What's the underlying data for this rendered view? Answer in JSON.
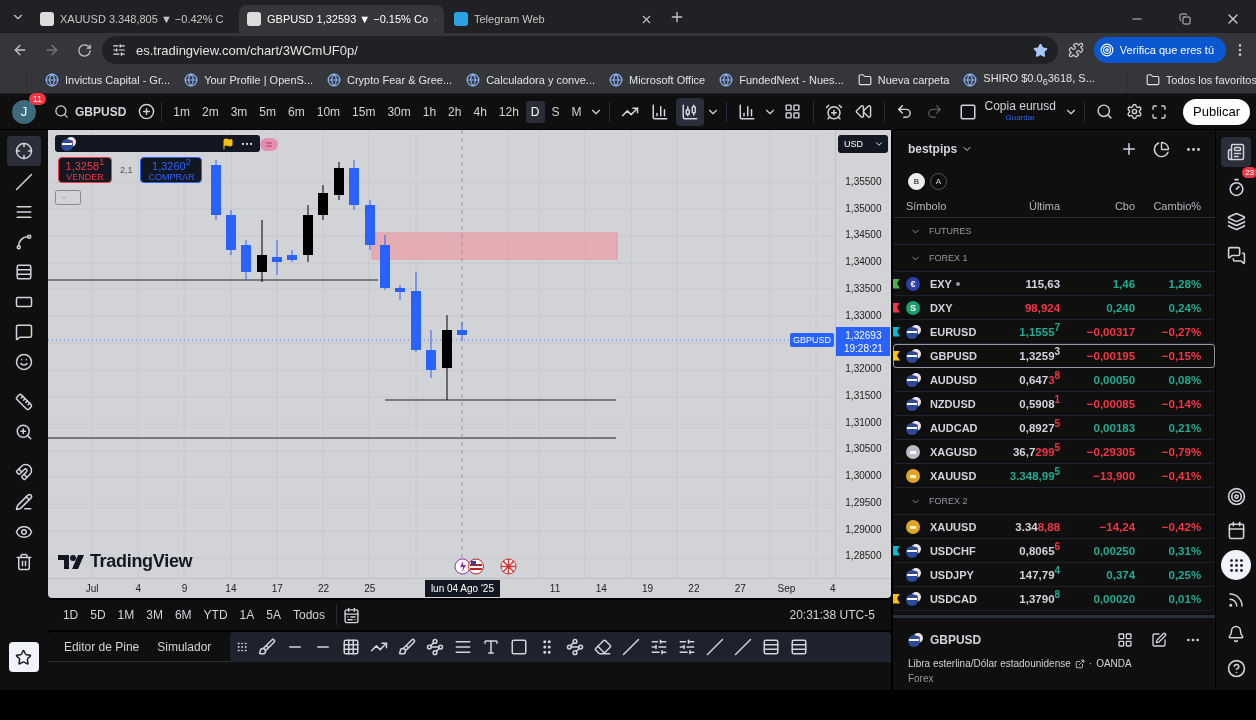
{
  "browser": {
    "tabs": [
      {
        "title": "XAUUSD 3.348,805 ▼ −0.42% C",
        "selected": false
      },
      {
        "title": "GBPUSD 1,32593 ▼ −0.15% Co",
        "selected": true
      },
      {
        "title": "Telegram Web",
        "selected": false
      }
    ],
    "url": "es.tradingview.com/chart/3WCmUF0p/",
    "verify": "Verifica que eres tú",
    "bookmarks": [
      {
        "label": "Invictus Capital - Gr...",
        "kind": "site"
      },
      {
        "label": "Your Profile | OpenS...",
        "kind": "site"
      },
      {
        "label": "Crypto Fear & Gree...",
        "kind": "site"
      },
      {
        "label": "Calculadora y conve...",
        "kind": "site"
      },
      {
        "label": "Microsoft Office",
        "kind": "site"
      },
      {
        "label": "FundedNext - Nues...",
        "kind": "site"
      },
      {
        "label": "Nueva carpeta",
        "kind": "folder"
      },
      {
        "label": "SHIRO $0.0$_{6}$3618, S...",
        "kind": "site"
      }
    ],
    "all_bookmarks": "Todos los favoritos"
  },
  "toolbar": {
    "avatar": "J",
    "badge": "11",
    "symbol": "GBPUSD",
    "intervals": [
      {
        "label": "1m",
        "selected": false
      },
      {
        "label": "2m",
        "selected": false
      },
      {
        "label": "3m",
        "selected": false
      },
      {
        "label": "5m",
        "selected": false
      },
      {
        "label": "6m",
        "selected": false
      },
      {
        "label": "10m",
        "selected": false
      },
      {
        "label": "15m",
        "selected": false
      },
      {
        "label": "30m",
        "selected": false
      },
      {
        "label": "1h",
        "selected": false
      },
      {
        "label": "2h",
        "selected": false
      },
      {
        "label": "4h",
        "selected": false
      },
      {
        "label": "12h",
        "selected": false
      },
      {
        "label": "D",
        "selected": true
      },
      {
        "label": "S",
        "selected": false
      },
      {
        "label": "M",
        "selected": false
      }
    ],
    "layout_name": "Copia eurusd",
    "layout_status": "Guardar",
    "publish": "Publicar"
  },
  "chart": {
    "sell": {
      "price": "1,3258$^{1}$",
      "label": "VENDER"
    },
    "spread": "2,1",
    "buy": {
      "price": "1,3260$^{2}$",
      "label": "COMPRAR"
    },
    "currency": "USD",
    "symbol_tag": "GBPUSD",
    "logo": "TradingView",
    "price_axis": [
      {
        "kind": "tick",
        "text": "1,35500"
      },
      {
        "kind": "tick",
        "text": "1,35000"
      },
      {
        "kind": "tick",
        "text": "1,34500"
      },
      {
        "kind": "tick",
        "text": "1,34000"
      },
      {
        "kind": "tick",
        "text": "1,33500"
      },
      {
        "kind": "tick",
        "text": "1,33000"
      },
      {
        "kind": "current",
        "text": "1,32693",
        "countdown": "19:28:21"
      },
      {
        "kind": "tick",
        "text": "1,32000"
      },
      {
        "kind": "tick",
        "text": "1,31500"
      },
      {
        "kind": "tick",
        "text": "1,31000"
      },
      {
        "kind": "tick",
        "text": "1,30500"
      },
      {
        "kind": "tick",
        "text": "1,30000"
      },
      {
        "kind": "tick",
        "text": "1,29500"
      },
      {
        "kind": "tick",
        "text": "1,29000"
      },
      {
        "kind": "tick",
        "text": "1,28500"
      }
    ],
    "time_axis": [
      {
        "kind": "tick",
        "text": "Jul"
      },
      {
        "kind": "tick",
        "text": "4"
      },
      {
        "kind": "tick",
        "text": "9"
      },
      {
        "kind": "tick",
        "text": "14"
      },
      {
        "kind": "tick",
        "text": "17"
      },
      {
        "kind": "tick",
        "text": "22"
      },
      {
        "kind": "tick",
        "text": "25"
      },
      {
        "kind": "crosshair",
        "text": "lun 04 Ago '25"
      },
      {
        "kind": "tick",
        "text": "11"
      },
      {
        "kind": "tick",
        "text": "14"
      },
      {
        "kind": "tick",
        "text": "19"
      },
      {
        "kind": "tick",
        "text": "22"
      },
      {
        "kind": "tick",
        "text": "27"
      },
      {
        "kind": "tick",
        "text": "Sep"
      },
      {
        "kind": "tick",
        "text": "4"
      }
    ]
  },
  "ranges": [
    "1D",
    "5D",
    "1M",
    "3M",
    "6M",
    "YTD",
    "1A",
    "5A",
    "Todos"
  ],
  "clock": "20:31:38 UTC-5",
  "bottom_tabs": [
    "Editor de Pine",
    "Simulador"
  ],
  "watchlist": {
    "title": "bestpips",
    "chips": [
      {
        "label": "B",
        "selected": true
      },
      {
        "label": "A",
        "selected": false
      }
    ],
    "columns": [
      "Símbolo",
      "Última",
      "Cbo",
      "Cambio%"
    ],
    "sections": [
      {
        "title": "FUTURES"
      },
      {
        "title": "FOREX 1",
        "rows": [
          {
            "symbol": "EXY",
            "kind": "euro-index",
            "icon_text": "€",
            "dot": true,
            "color": "#4caf50",
            "selected": false,
            "last": [
              {
                "text": "115,63",
                "color": "#d1d4dc"
              }
            ],
            "change": {
              "text": "1,46",
              "color": "#22ab94"
            },
            "change_pct": {
              "text": "1,28%",
              "color": "#22ab94"
            }
          },
          {
            "symbol": "DXY",
            "kind": "dollar-index",
            "icon_text": "S",
            "dot": false,
            "color": "#f23645",
            "selected": false,
            "last": [
              {
                "text": "98,924",
                "color": "#f23645"
              }
            ],
            "change": {
              "text": "0,240",
              "color": "#22ab94"
            },
            "change_pct": {
              "text": "0,24%",
              "color": "#22ab94"
            }
          },
          {
            "symbol": "EURUSD",
            "kind": "pair",
            "dot": false,
            "color": "#00bcd4",
            "selected": false,
            "last": [
              {
                "text": "1,1555$^{7}$",
                "color": "#22ab94"
              }
            ],
            "change": {
              "text": "−0,00317",
              "color": "#f23645"
            },
            "change_pct": {
              "text": "−0,27%",
              "color": "#f23645"
            }
          },
          {
            "symbol": "GBPUSD",
            "kind": "pair",
            "dot": false,
            "color": "#ffc107",
            "selected": true,
            "last": [
              {
                "text": "1,3259$^{3}$",
                "color": "#d1d4dc"
              }
            ],
            "change": {
              "text": "−0,00195",
              "color": "#f23645"
            },
            "change_pct": {
              "text": "−0,15%",
              "color": "#f23645"
            }
          },
          {
            "symbol": "AUDUSD",
            "kind": "pair",
            "dot": false,
            "selected": false,
            "last": [
              {
                "text": "0,647",
                "color": "#d1d4dc"
              },
              {
                "text": "3$^{8}$",
                "color": "#f23645"
              }
            ],
            "change": {
              "text": "0,00050",
              "color": "#22ab94"
            },
            "change_pct": {
              "text": "0,08%",
              "color": "#22ab94"
            }
          },
          {
            "symbol": "NZDUSD",
            "kind": "pair",
            "dot": false,
            "selected": false,
            "last": [
              {
                "text": "0,5908",
                "color": "#d1d4dc"
              },
              {
                "text": "$^{1}$",
                "color": "#f23645"
              }
            ],
            "change": {
              "text": "−0,00085",
              "color": "#f23645"
            },
            "change_pct": {
              "text": "−0,14%",
              "color": "#f23645"
            }
          },
          {
            "symbol": "AUDCAD",
            "kind": "pair",
            "dot": false,
            "selected": false,
            "last": [
              {
                "text": "0,8927",
                "color": "#d1d4dc"
              },
              {
                "text": "$^{5}$",
                "color": "#f23645"
              }
            ],
            "change": {
              "text": "0,00183",
              "color": "#22ab94"
            },
            "change_pct": {
              "text": "0,21%",
              "color": "#22ab94"
            }
          },
          {
            "symbol": "XAGUSD",
            "kind": "silver",
            "dot": false,
            "selected": false,
            "last": [
              {
                "text": "36,7",
                "color": "#d1d4dc"
              },
              {
                "text": "299$^{5}$",
                "color": "#f23645"
              }
            ],
            "change": {
              "text": "−0,29305",
              "color": "#f23645"
            },
            "change_pct": {
              "text": "−0,79%",
              "color": "#f23645"
            }
          },
          {
            "symbol": "XAUUSD",
            "kind": "gold",
            "dot": false,
            "selected": false,
            "last": [
              {
                "text": "3.348,99$^{5}$",
                "color": "#22ab94"
              }
            ],
            "change": {
              "text": "−13,900",
              "color": "#f23645"
            },
            "change_pct": {
              "text": "−0,41%",
              "color": "#f23645"
            }
          }
        ]
      },
      {
        "title": "FOREX 2",
        "rows": [
          {
            "symbol": "XAUUSD",
            "kind": "gold",
            "dot": false,
            "selected": false,
            "last": [
              {
                "text": "3.34",
                "color": "#d1d4dc"
              },
              {
                "text": "8,88",
                "color": "#f23645"
              }
            ],
            "change": {
              "text": "−14,24",
              "color": "#f23645"
            },
            "change_pct": {
              "text": "−0,42%",
              "color": "#f23645"
            }
          },
          {
            "symbol": "USDCHF",
            "kind": "pair",
            "dot": false,
            "color": "#00bcd4",
            "selected": false,
            "last": [
              {
                "text": "0,8065",
                "color": "#d1d4dc"
              },
              {
                "text": "$^{6}$",
                "color": "#f23645"
              }
            ],
            "change": {
              "text": "0,00250",
              "color": "#22ab94"
            },
            "change_pct": {
              "text": "0,31%",
              "color": "#22ab94"
            }
          },
          {
            "symbol": "USDJPY",
            "kind": "pair",
            "dot": false,
            "selected": false,
            "last": [
              {
                "text": "147,79",
                "color": "#d1d4dc"
              },
              {
                "text": "$^{4}$",
                "color": "#22ab94"
              }
            ],
            "change": {
              "text": "0,374",
              "color": "#22ab94"
            },
            "change_pct": {
              "text": "0,25%",
              "color": "#22ab94"
            }
          },
          {
            "symbol": "USDCAD",
            "kind": "pair",
            "dot": false,
            "color": "#ffc107",
            "selected": false,
            "last": [
              {
                "text": "1,3790",
                "color": "#d1d4dc"
              },
              {
                "text": "$^{8}$",
                "color": "#22ab94"
              }
            ],
            "change": {
              "text": "0,00020",
              "color": "#22ab94"
            },
            "change_pct": {
              "text": "0,01%",
              "color": "#22ab94"
            }
          }
        ]
      }
    ],
    "detail": {
      "symbol": "GBPUSD",
      "description": "Libra esterlina/Dólar estadounidense",
      "separator": "·",
      "exchange": "OANDA",
      "type": "Forex"
    }
  },
  "rail_badge": "23"
}
